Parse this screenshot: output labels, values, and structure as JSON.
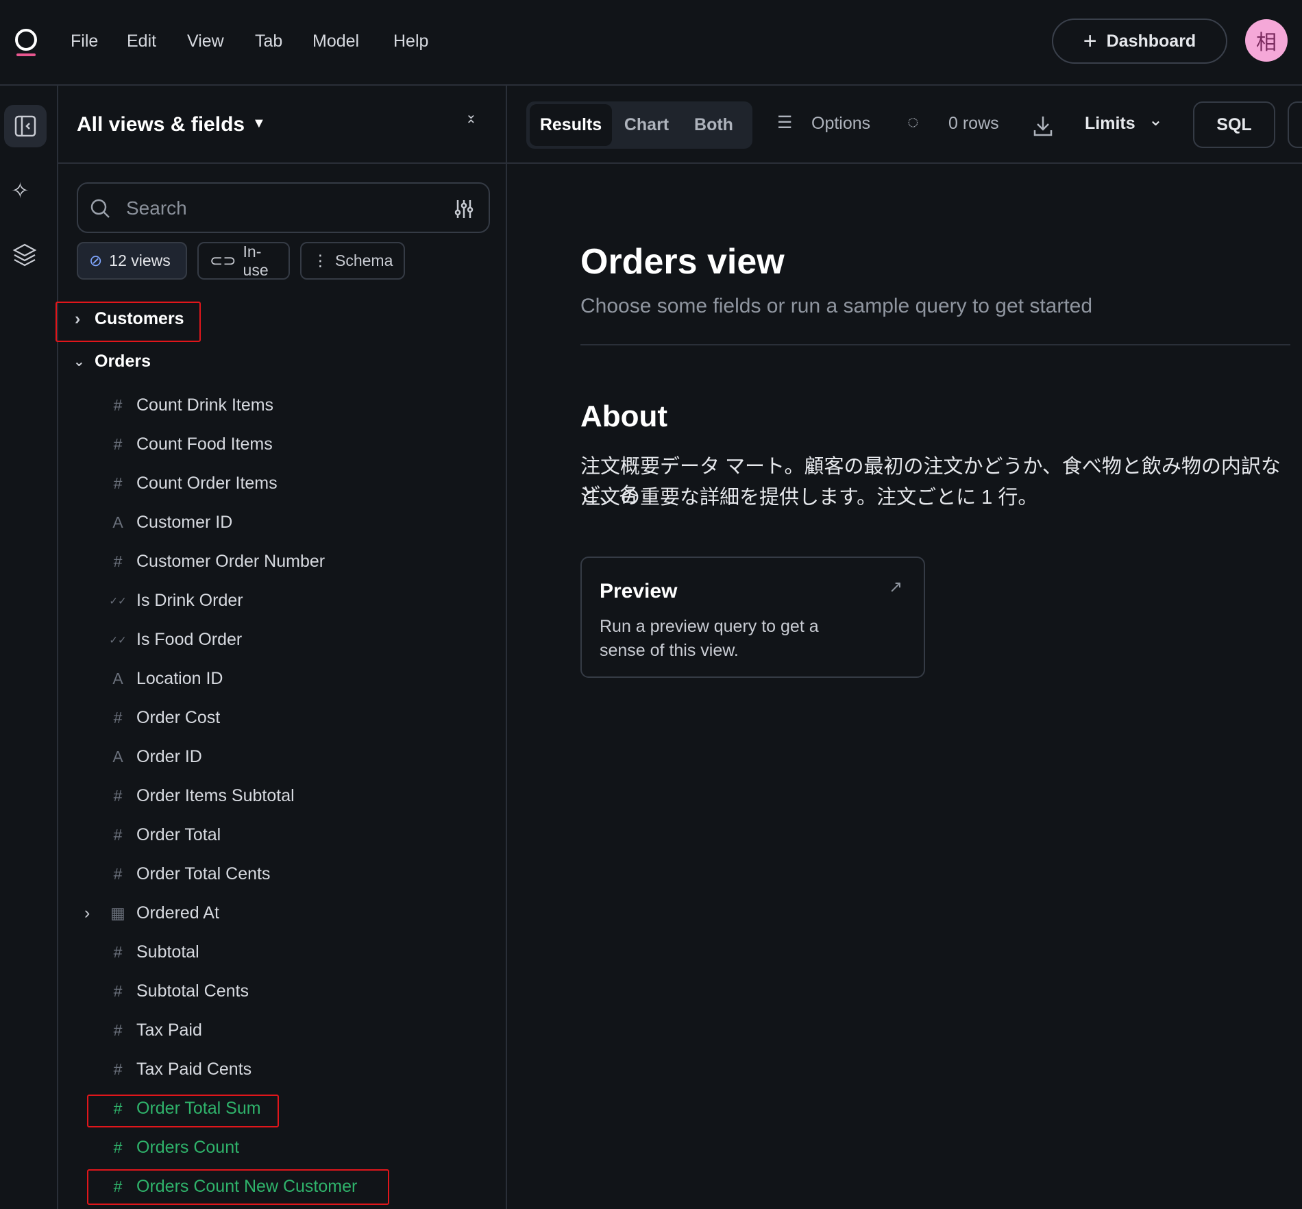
{
  "menu": [
    "File",
    "Edit",
    "View",
    "Tab",
    "Model",
    "Help"
  ],
  "header": {
    "dashboard_label": "Dashboard",
    "avatar_text": "相"
  },
  "sidebar": {
    "title": "All views & fields",
    "search_placeholder": "Search",
    "chips": [
      {
        "label": "12 views",
        "icon": "eye-off-icon"
      },
      {
        "label": "In-use",
        "icon": "toggle-icon"
      },
      {
        "label": "Schema",
        "icon": "schema-icon"
      }
    ],
    "groups": [
      {
        "label": "Customers",
        "expanded": false
      },
      {
        "label": "Orders",
        "expanded": true
      }
    ],
    "fields": [
      {
        "label": "Count Drink Items",
        "type": "number"
      },
      {
        "label": "Count Food Items",
        "type": "number"
      },
      {
        "label": "Count Order Items",
        "type": "number"
      },
      {
        "label": "Customer ID",
        "type": "string"
      },
      {
        "label": "Customer Order Number",
        "type": "number"
      },
      {
        "label": "Is Drink Order",
        "type": "boolean"
      },
      {
        "label": "Is Food Order",
        "type": "boolean"
      },
      {
        "label": "Location ID",
        "type": "string"
      },
      {
        "label": "Order Cost",
        "type": "number"
      },
      {
        "label": "Order ID",
        "type": "string"
      },
      {
        "label": "Order Items Subtotal",
        "type": "number"
      },
      {
        "label": "Order Total",
        "type": "number"
      },
      {
        "label": "Order Total Cents",
        "type": "number"
      },
      {
        "label": "Ordered At",
        "type": "date"
      },
      {
        "label": "Subtotal",
        "type": "number"
      },
      {
        "label": "Subtotal Cents",
        "type": "number"
      },
      {
        "label": "Tax Paid",
        "type": "number"
      },
      {
        "label": "Tax Paid Cents",
        "type": "number"
      },
      {
        "label": "Order Total Sum",
        "type": "measure"
      },
      {
        "label": "Orders Count",
        "type": "measure"
      },
      {
        "label": "Orders Count New Customer",
        "type": "measure"
      }
    ]
  },
  "toolbar": {
    "tabs": [
      "Results",
      "Chart",
      "Both"
    ],
    "active_tab": "Results",
    "options": "Options",
    "rows": "0 rows",
    "limits": "Limits",
    "sql": "SQL"
  },
  "main": {
    "title": "Orders view",
    "subtitle": "Choose some fields or run a sample query to get started",
    "about_heading": "About",
    "about_line1": "注文概要データ マート。顧客の最初の注文かどうか、食べ物と飲み物の内訳など、各",
    "about_line2": "注文の重要な詳細を提供します。注文ごとに 1 行。",
    "preview": {
      "title": "Preview",
      "line1": "Run a preview query to get a",
      "line2": "sense of this view."
    }
  },
  "colors": {
    "measure": "#2fb36b",
    "highlight": "#e0161b",
    "avatar": "#f5a8d8"
  }
}
